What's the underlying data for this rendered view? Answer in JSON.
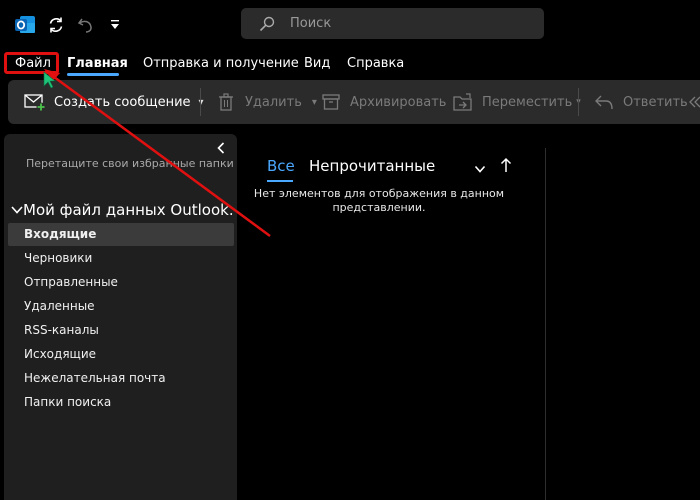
{
  "titlebar": {
    "icons": [
      "outlook-logo",
      "sync-icon",
      "undo-icon",
      "customize-qat-icon"
    ],
    "search": {
      "placeholder": "Поиск"
    }
  },
  "menu": {
    "tabs": [
      "Файл",
      "Главная",
      "Отправка и получение",
      "Вид",
      "Справка"
    ],
    "active_tab": "Главная"
  },
  "ribbon": {
    "new_message": "Создать сообщение",
    "delete": "Удалить",
    "archive": "Архивировать",
    "move": "Переместить",
    "reply": "Ответить"
  },
  "folder_pane": {
    "drag_hint": "Перетащите свои избранные папки сю",
    "account": "Мой файл данных Outlook...",
    "folders": [
      "Входящие",
      "Черновики",
      "Отправленные",
      "Удаленные",
      "RSS-каналы",
      "Исходящие",
      "Нежелательная почта",
      "Папки поиска"
    ],
    "selected_folder": "Входящие"
  },
  "message_list": {
    "filter_all": "Все",
    "filter_unread": "Непрочитанные",
    "empty_text": "Нет элементов для отображения в данном представлении."
  },
  "colors": {
    "accent": "#4aa8ff",
    "annotation": "#e01010",
    "pane_bg": "#1f1f1f",
    "ribbon_bg": "#2b2b2b"
  }
}
